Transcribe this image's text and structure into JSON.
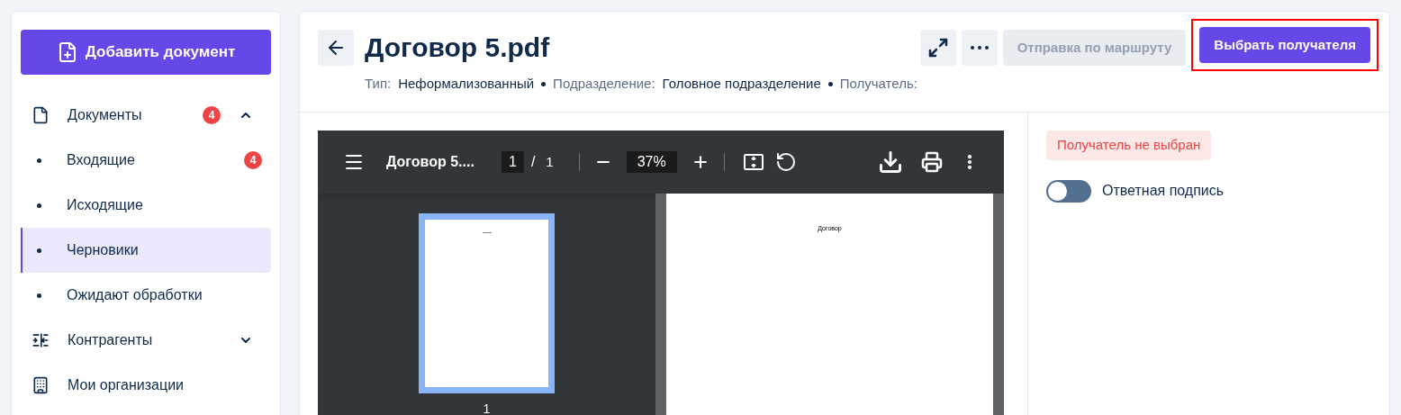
{
  "sidebar": {
    "add_button": "Добавить документ",
    "items": [
      {
        "kind": "group",
        "label": "Документы",
        "badge": "4",
        "expanded": true,
        "children": [
          {
            "label": "Входящие",
            "badge": "4",
            "selected": false
          },
          {
            "label": "Исходящие",
            "selected": false
          },
          {
            "label": "Черновики",
            "selected": true
          },
          {
            "label": "Ожидают обработки",
            "selected": false
          }
        ]
      },
      {
        "kind": "group",
        "label": "Контрагенты",
        "expanded": false
      },
      {
        "kind": "link",
        "label": "Мои организации"
      }
    ]
  },
  "header": {
    "title": "Договор 5.pdf",
    "meta": [
      {
        "label": "Тип:",
        "value": "Неформализованный"
      },
      {
        "label": "Подразделение:",
        "value": "Головное подразделение"
      },
      {
        "label": "Получатель:"
      }
    ],
    "buttons": [
      {
        "label": "Отправка по маршруту",
        "disabled": true,
        "highlighted": false
      },
      {
        "label": "Выбрать получателя",
        "disabled": false,
        "highlighted": true
      }
    ]
  },
  "viewer": {
    "file_name": "Договор 5....",
    "page": "1",
    "separator": "/",
    "total_pages": "1",
    "zoom": "37%",
    "page_text": "Договор",
    "thumbnail_label": "1"
  },
  "panel": {
    "status": "Получатель не выбран",
    "toggle": {
      "label": "Ответная подпись",
      "on": false
    }
  }
}
